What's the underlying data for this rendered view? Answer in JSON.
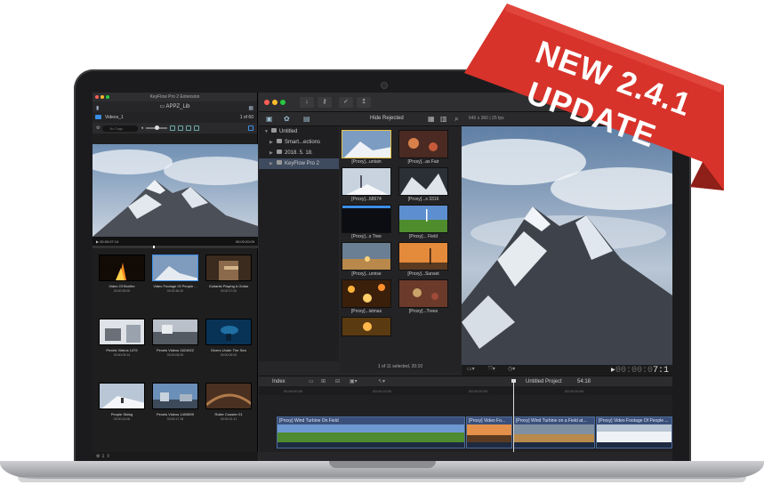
{
  "banner": {
    "line1": "NEW 2.4.1",
    "line2": "UPDATE",
    "color": "#d7332b"
  },
  "extension": {
    "window_title": "KeyFlow Pro 2 Extension",
    "library": "APPZ_Lib",
    "folder": "Videos_1",
    "count": "1 of 60",
    "search_placeholder": "No Tags",
    "preview_time_start": "00:00:07:14",
    "preview_time_end": "00:00:20:09",
    "items": [
      {
        "name": "Video Of Bonfire",
        "duration": "00:00:05:00"
      },
      {
        "name": "Video Footage Of People ...",
        "duration": "00:00:46:20"
      },
      {
        "name": "Guitarist Playing A Guitar",
        "duration": "00:00:17:00"
      },
      {
        "name": "Pexels Videos 1479",
        "duration": "00:00:03:14"
      },
      {
        "name": "Pexels Videos 1624922",
        "duration": "00:00:06:09"
      },
      {
        "name": "Divers Under The Sea",
        "duration": "00:00:09:00"
      },
      {
        "name": "People Skiing",
        "duration": "00:00:14:06"
      },
      {
        "name": "Pexels Videos 1409899",
        "duration": "00:00:17:18"
      },
      {
        "name": "Roller Coaster 01",
        "duration": "00:00:21:11"
      }
    ]
  },
  "fcp": {
    "filter": "Hide Rejected",
    "resolution": "640 x 360 | 25 fps",
    "library_tree": [
      {
        "label": "Untitled",
        "level": 0
      },
      {
        "label": "Smart...ections",
        "level": 1
      },
      {
        "label": "2018. 5. 18.",
        "level": 1
      },
      {
        "label": "KeyFlow Pro 2",
        "level": 1
      }
    ],
    "clips": [
      {
        "name": "[Proxy]...untain"
      },
      {
        "name": "[Proxy]...as Fair"
      },
      {
        "name": "[Proxy]...68674"
      },
      {
        "name": "[Proxy]...s 3316"
      },
      {
        "name": "[Proxy]...s Tree"
      },
      {
        "name": "[Proxy]... Field"
      },
      {
        "name": "[Proxy]...unrise"
      },
      {
        "name": "[Proxy]...Sunset"
      },
      {
        "name": "[Proxy]...istmas"
      },
      {
        "name": "[Proxy]...Trees"
      },
      {
        "name": ""
      }
    ],
    "status": "1 of 11 selected, 20:10",
    "timecode_dim": "00:00:0",
    "timecode_bright": "7:1",
    "timeline": {
      "index_label": "Index",
      "project": "Untitled Project",
      "duration": "54:18",
      "ruler": [
        "00:00:00:00",
        "00:00:10:00",
        "00:00:20:00",
        "00:00:30:00"
      ],
      "clips": [
        {
          "label": "[Proxy] Wind Turbine On Field"
        },
        {
          "label": "[Proxy] Video Fo..."
        },
        {
          "label": "[Proxy] Wind Turbine on a Field at..."
        },
        {
          "label": "[Proxy] Video Footage Of People ..."
        }
      ]
    }
  }
}
